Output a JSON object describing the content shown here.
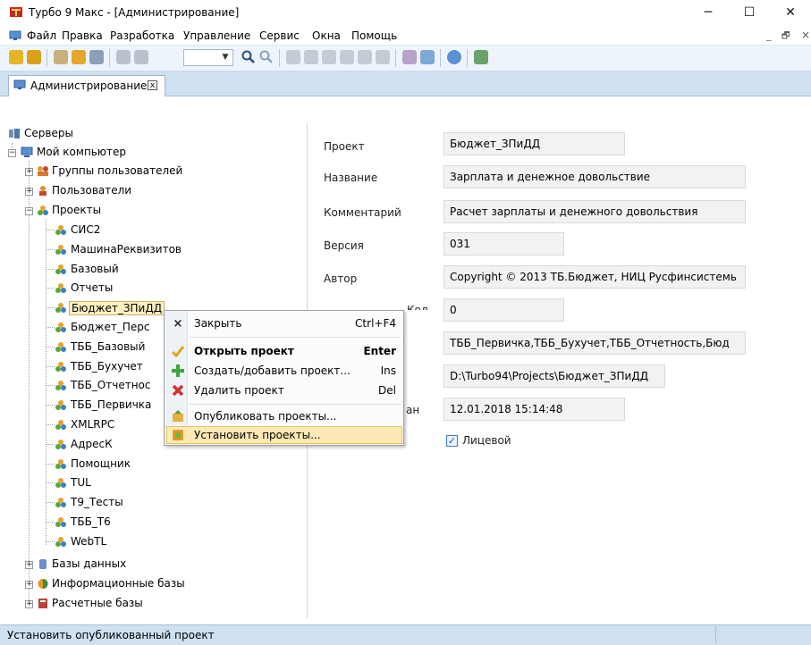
{
  "window": {
    "title": "Турбо 9 Макс - [Администрирование]",
    "minimize_glyph": "─",
    "maximize_glyph": "☐",
    "close_glyph": "✕"
  },
  "menu": {
    "items": [
      "Файл",
      "Правка",
      "Разработка",
      "Управление",
      "Сервис",
      "Окна",
      "Помощь"
    ],
    "mdi_controls": [
      "_",
      "🗗",
      "×"
    ]
  },
  "tab": {
    "label": "Администрирование",
    "close_glyph": "x"
  },
  "tree": {
    "root": "Серверы",
    "computer": "Мой компьютер",
    "groups": "Группы пользователей",
    "users": "Пользователи",
    "projects": "Проекты",
    "project_items": [
      "СИС2",
      "МашинаРеквизитов",
      "Базовый",
      "Отчеты",
      "Бюджет_ЗПиДД",
      "Бюджет_Перс",
      "ТББ_Базовый",
      "ТББ_Бухучет",
      "ТББ_Отчетнос",
      "ТББ_Первичка",
      "XMLRPC",
      "АдресК",
      "Помощник",
      "TUL",
      "T9_Тесты",
      "ТББ_Т6",
      "WebTL"
    ],
    "databases": "Базы данных",
    "info_bases": "Информационные базы",
    "calc_bases": "Расчетные базы"
  },
  "properties": {
    "project_label": "Проект",
    "project_value": "Бюджет_ЗПиДД",
    "name_label": "Название",
    "name_value": "Зарплата и денежное довольствие",
    "comment_label": "Комментарий",
    "comment_value": "Расчет зарплаты и денежного довольствия",
    "version_label": "Версия",
    "version_value": "031",
    "author_label": "Автор",
    "author_value": "Copyright © 2013 ТБ.Бюджет, НИЦ Русфинсистемь",
    "code_label_partial": "Код",
    "code_value": "0",
    "deps_value": "ТББ_Первичка,ТББ_Бухучет,ТББ_Отчетность,Бюд",
    "path_value": "D:\\Turbo94\\Projects\\Бюджет_ЗПиДД",
    "created_label_partial": "ан",
    "created_value": "12.01.2018 15:14:48",
    "face_label": "Лицевой",
    "face_checked": "✓"
  },
  "context_menu": {
    "close": {
      "label": "Закрыть",
      "shortcut": "Ctrl+F4"
    },
    "open": {
      "label": "Открыть проект",
      "shortcut": "Enter"
    },
    "create": {
      "label": "Создать/добавить проект...",
      "shortcut": "Ins"
    },
    "delete": {
      "label": "Удалить проект",
      "shortcut": "Del"
    },
    "publish": {
      "label": "Опубликовать проекты..."
    },
    "install": {
      "label": "Установить проекты..."
    }
  },
  "status": {
    "text": "Установить опубликованный проект"
  },
  "colors": {
    "toolbar_bg": "#eef4fb",
    "tabstrip_bg": "#cfe0f1",
    "highlight": "#fde9b4",
    "field_bg": "#f2f2f2"
  }
}
